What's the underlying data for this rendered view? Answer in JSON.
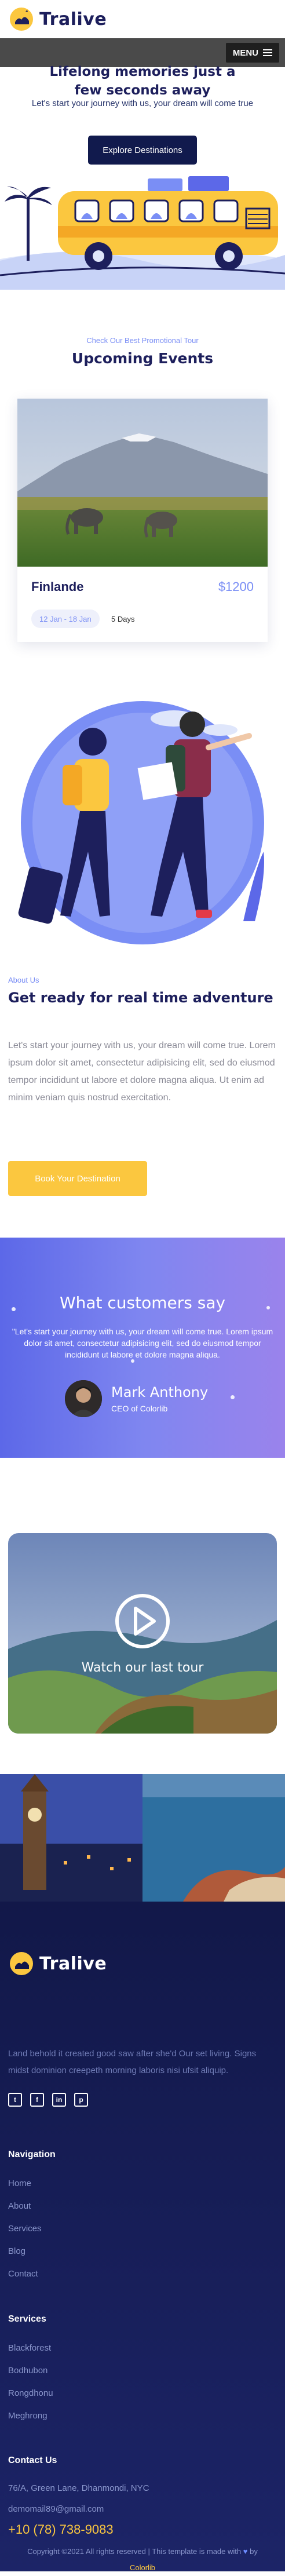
{
  "header": {
    "brand": "Tralive",
    "menu_label": "MENU"
  },
  "hero": {
    "title_line1": "Lifelong memories just a",
    "title_line2": "few seconds away",
    "subtitle": "Let's start your journey with us, your dream will come true",
    "cta": "Explore Destinations"
  },
  "events": {
    "eyebrow": "Check Our Best Promotional Tour",
    "title": "Upcoming Events",
    "card": {
      "name": "Finlande",
      "price": "$1200",
      "dates": "12 Jan - 18 Jan",
      "days": "5 Days"
    }
  },
  "about": {
    "eyebrow": "About Us",
    "title": "Get ready for real time adventure",
    "text": "Let's start your journey with us, your dream will come true. Lorem ipsum dolor sit amet, consectetur adipisicing elit, sed do eiusmod tempor incididunt ut labore et dolore magna aliqua. Ut enim ad minim veniam quis nostrud exercitation.",
    "cta": "Book Your Destination"
  },
  "testimonials": {
    "title": "What customers say",
    "quote": "\"Let's start your journey with us, your dream will come true. Lorem ipsum dolor sit amet, consectetur adipisicing elit, sed do eiusmod tempor incididunt ut labore et dolore magna aliqua.",
    "name": "Mark Anthony",
    "role": "CEO of Colorlib"
  },
  "video": {
    "label": "Watch our last tour"
  },
  "footer": {
    "brand": "Tralive",
    "description": "Land behold it created good saw after she'd Our set living. Signs midst dominion creepeth morning laboris nisi ufsit aliquip.",
    "socials": [
      "twitter-icon",
      "facebook-icon",
      "linkedin-icon",
      "pinterest-icon"
    ],
    "navigation": {
      "heading": "Navigation",
      "links": [
        "Home",
        "About",
        "Services",
        "Blog",
        "Contact"
      ]
    },
    "services": {
      "heading": "Services",
      "links": [
        "Blackforest",
        "Bodhubon",
        "Rongdhonu",
        "Meghrong"
      ]
    },
    "contact": {
      "heading": "Contact Us",
      "address": "76/A, Green Lane, Dhanmondi, NYC",
      "email": "demomail89@gmail.com",
      "phone": "+10 (78) 738-9083"
    },
    "copyright_text": "Copyright ©2021 All rights reserved | This template is made with",
    "heart": "♥",
    "by_label": "by",
    "copyright_credit": "Colorlib"
  },
  "colors": {
    "navy": "#1d1f5c",
    "accent_blue": "#7a8ef5",
    "yellow": "#fbc73f",
    "footer_bg": "#121849"
  }
}
